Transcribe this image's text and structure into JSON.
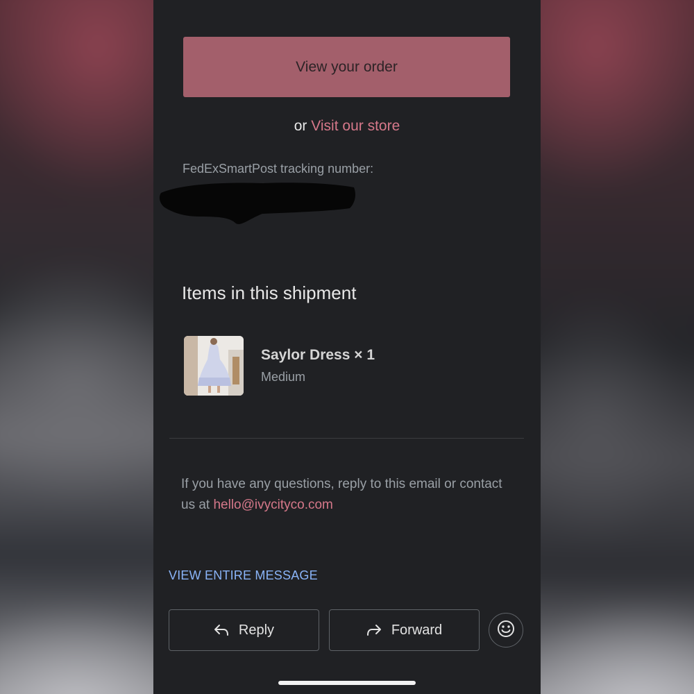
{
  "email": {
    "order_button_label": "View your order",
    "store_prefix": "or",
    "store_link_label": "Visit our store",
    "tracking_label": "FedExSmartPost tracking number:",
    "items_title": "Items in this shipment",
    "product": {
      "name": "Saylor Dress × 1",
      "variant": "Medium"
    },
    "questions_text": "If you have any questions, reply to this email or contact us at",
    "contact_email": "hello@ivycityco.com"
  },
  "footer": {
    "view_entire_label": "VIEW ENTIRE MESSAGE",
    "reply_label": "Reply",
    "forward_label": "Forward"
  },
  "colors": {
    "background": "#202124",
    "accent_button": "#a35f6b",
    "link": "#d6788a",
    "secondary_text": "#9aa0a6",
    "action_link": "#8ab4f8"
  },
  "icons": {
    "reply": "reply-arrow-icon",
    "forward": "forward-arrow-icon",
    "emoji": "smiley-face-icon"
  }
}
